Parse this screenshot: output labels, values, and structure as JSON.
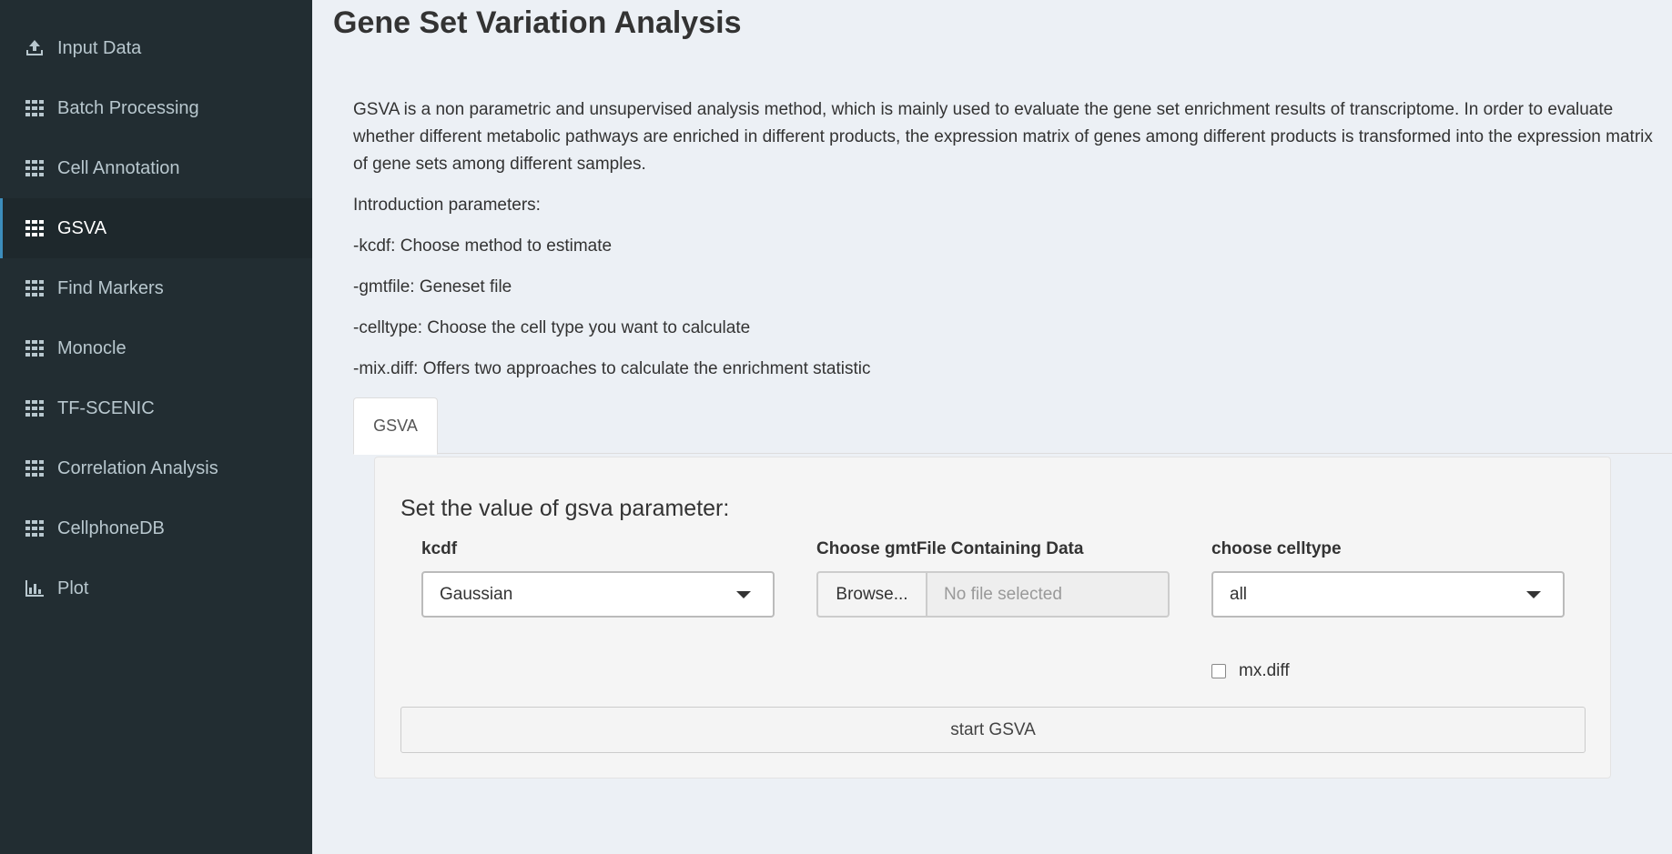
{
  "sidebar": {
    "items": [
      {
        "label": "Input Data",
        "icon": "upload-icon",
        "active": false
      },
      {
        "label": "Batch Processing",
        "icon": "grid-icon",
        "active": false
      },
      {
        "label": "Cell Annotation",
        "icon": "grid-icon",
        "active": false
      },
      {
        "label": "GSVA",
        "icon": "grid-icon",
        "active": true
      },
      {
        "label": "Find Markers",
        "icon": "grid-icon",
        "active": false
      },
      {
        "label": "Monocle",
        "icon": "grid-icon",
        "active": false
      },
      {
        "label": "TF-SCENIC",
        "icon": "grid-icon",
        "active": false
      },
      {
        "label": "Correlation Analysis",
        "icon": "grid-icon",
        "active": false
      },
      {
        "label": "CellphoneDB",
        "icon": "grid-icon",
        "active": false
      },
      {
        "label": "Plot",
        "icon": "bar-chart-icon",
        "active": false
      }
    ]
  },
  "main": {
    "title": "Gene Set Variation Analysis",
    "description": "GSVA is a non parametric and unsupervised analysis method, which is mainly used to evaluate the gene set enrichment results of transcriptome. In order to evaluate whether different metabolic pathways are enriched in different products, the expression matrix of genes among different products is transformed into the expression matrix of gene sets among different samples.",
    "intro_heading": "Introduction parameters:",
    "params": [
      "-kcdf: Choose method to estimate",
      "-gmtfile: Geneset file",
      "-celltype: Choose the cell type you want to calculate",
      "-mix.diff: Offers two approaches to calculate the enrichment statistic"
    ],
    "tab_label": "GSVA"
  },
  "form": {
    "heading": "Set the value of gsva parameter:",
    "kcdf": {
      "label": "kcdf",
      "value": "Gaussian"
    },
    "gmt": {
      "label": "Choose gmtFile Containing Data",
      "browse_label": "Browse...",
      "file_text": "No file selected"
    },
    "celltype": {
      "label": "choose celltype",
      "value": "all"
    },
    "mxdiff": {
      "label": "mx.diff",
      "checked": false
    },
    "start_label": "start GSVA"
  },
  "colors": {
    "sidebar_bg": "#222d32",
    "sidebar_active_bg": "#1e282c",
    "accent": "#3c8dbc",
    "content_bg": "#ecf0f5"
  }
}
